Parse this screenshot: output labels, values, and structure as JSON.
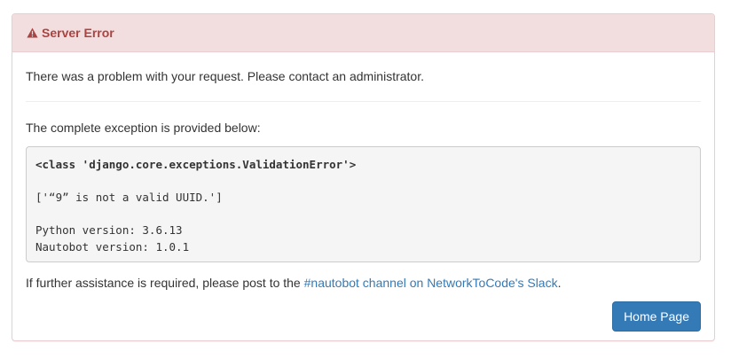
{
  "panel": {
    "title": "Server Error",
    "icon": "warning-icon",
    "colors": {
      "heading_bg": "#f2dede",
      "heading_text": "#a94442",
      "border": "#ebccd1",
      "link": "#337ab7",
      "button_bg": "#337ab7"
    }
  },
  "body": {
    "intro": "There was a problem with your request. Please contact an administrator.",
    "complete_label": "The complete exception is provided below:",
    "exception": {
      "class_line": "<class 'django.core.exceptions.ValidationError'>",
      "message": "['“9” is not a valid UUID.']",
      "python_version": "Python version: 3.6.13",
      "nautobot_version": "Nautobot version: 1.0.1"
    },
    "further_prefix": "If further assistance is required, please post to the ",
    "further_link": "#nautobot channel on NetworkToCode's Slack",
    "further_suffix": "."
  },
  "actions": {
    "home_label": "Home Page"
  }
}
